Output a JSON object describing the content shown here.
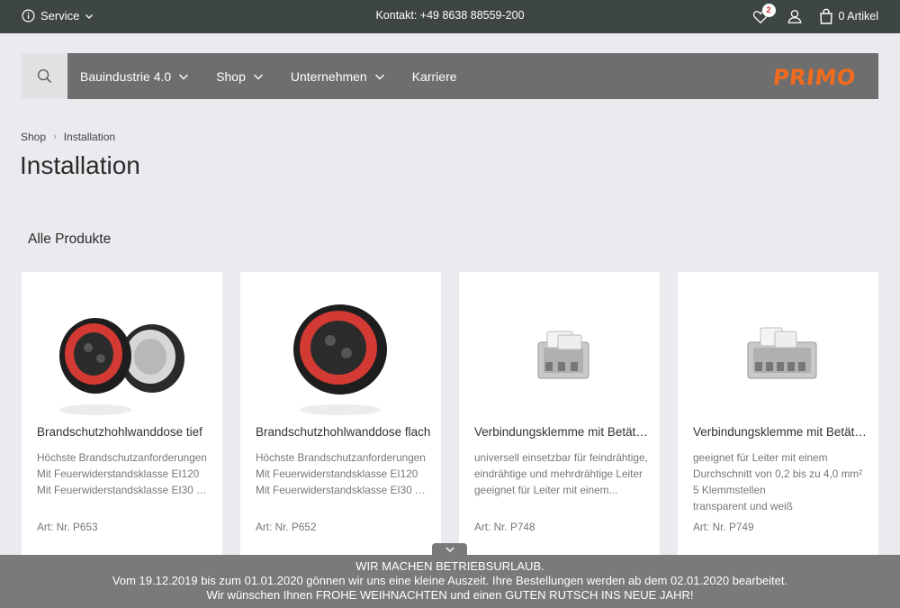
{
  "topbar": {
    "service_label": "Service",
    "contact": "Kontakt: +49 8638 88559-200",
    "wishlist_count": "2",
    "cart_label": "0 Artikel"
  },
  "nav": {
    "items": [
      {
        "label": "Bauindustrie 4.0"
      },
      {
        "label": "Shop"
      },
      {
        "label": "Unternehmen"
      },
      {
        "label": "Karriere"
      }
    ],
    "logo": "PRIMO"
  },
  "breadcrumb": [
    "Shop",
    "Installation"
  ],
  "page_title": "Installation",
  "section_title": "Alle Produkte",
  "products": [
    {
      "name": "Brandschutzhohlwanddose tief",
      "desc": [
        "Höchste Brandschutzanforderungen",
        "Mit Feuerwiderstandsklasse EI120",
        "Mit Feuerwiderstandsklasse EI30 bis..."
      ],
      "art": "Art: Nr. P653"
    },
    {
      "name": "Brandschutzhohlwanddose flach",
      "desc": [
        "Höchste Brandschutzanforderungen",
        "Mit Feuerwiderstandsklasse EI120",
        "Mit Feuerwiderstandsklasse EI30 bis..."
      ],
      "art": "Art: Nr. P652"
    },
    {
      "name": "Verbindungsklemme mit Betäti…",
      "desc": [
        "universell einsetzbar für feindrähtige,",
        "eindrähtige und mehrdrähtige Leiter",
        "geeignet für Leiter mit einem..."
      ],
      "art": "Art: Nr. P748"
    },
    {
      "name": "Verbindungsklemme mit Betäti…",
      "desc": [
        "geeignet für Leiter mit einem",
        "Durchschnitt von 0,2 bis zu 4,0 mm²",
        "5 Klemmstellen",
        "transparent und weiß"
      ],
      "art": "Art: Nr. P749"
    }
  ],
  "banner": {
    "line1": "WIR MACHEN BETRIEBSURLAUB.",
    "line2": "Vom 19.12.2019 bis zum 01.01.2020 gönnen wir uns eine kleine Auszeit. Ihre Bestellungen werden ab dem 02.01.2020 bearbeitet.",
    "line3": "Wir wünschen Ihnen FROHE WEIHNACHTEN und einen GUTEN RUTSCH INS NEUE JAHR!"
  },
  "colors": {
    "accent": "#f26b1d",
    "topbar": "#3e4644",
    "nav": "#6e6e6e",
    "badge_text": "#d62b2b"
  }
}
